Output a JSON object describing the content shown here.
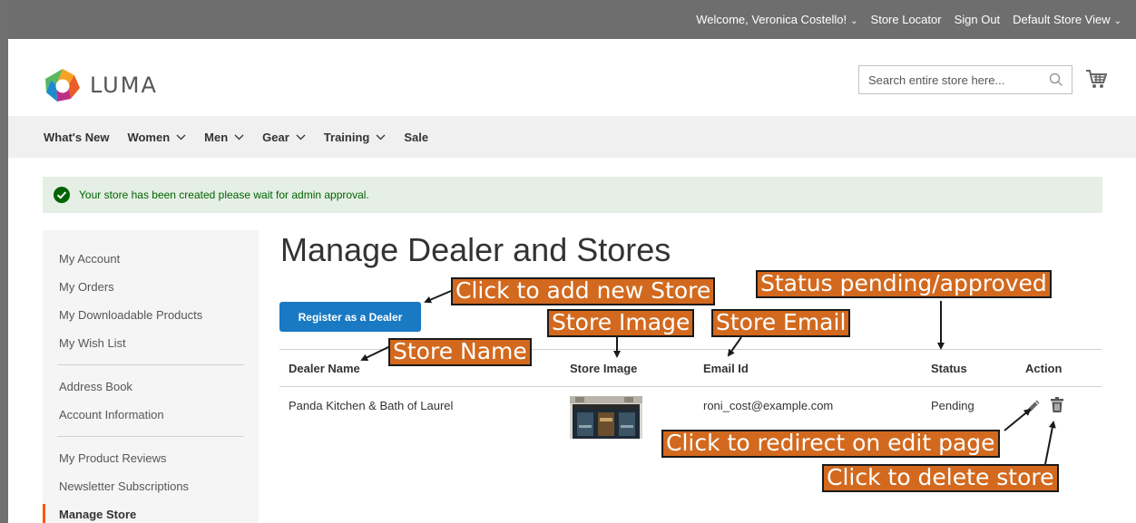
{
  "top_links": {
    "welcome": "Welcome, Veronica Costello!",
    "store_locator": "Store Locator",
    "sign_out": "Sign Out",
    "store_view": "Default Store View"
  },
  "brand": {
    "name": "LUMA"
  },
  "search": {
    "placeholder": "Search entire store here..."
  },
  "nav": {
    "items": [
      {
        "label": "What's New",
        "dropdown": false
      },
      {
        "label": "Women",
        "dropdown": true
      },
      {
        "label": "Men",
        "dropdown": true
      },
      {
        "label": "Gear",
        "dropdown": true
      },
      {
        "label": "Training",
        "dropdown": true
      },
      {
        "label": "Sale",
        "dropdown": false
      }
    ]
  },
  "message": {
    "text": "Your store has been created please wait for admin approval."
  },
  "sidebar": {
    "group1": [
      "My Account",
      "My Orders",
      "My Downloadable Products",
      "My Wish List"
    ],
    "group2": [
      "Address Book",
      "Account Information"
    ],
    "group3": [
      "My Product Reviews",
      "Newsletter Subscriptions",
      "Manage Store"
    ],
    "active": "Manage Store"
  },
  "page_title": "Manage Dealer and Stores",
  "register_button": "Register as a Dealer",
  "table": {
    "headers": {
      "dealer_name": "Dealer Name",
      "store_image": "Store Image",
      "email": "Email Id",
      "status": "Status",
      "action": "Action"
    },
    "rows": [
      {
        "dealer_name": "Panda Kitchen & Bath of Laurel",
        "email": "roni_cost@example.com",
        "status": "Pending"
      }
    ]
  },
  "annotations": {
    "add_store": "Click to add new Store",
    "status": "Status pending/approved",
    "store_image": "Store Image",
    "store_email": "Store Email",
    "store_name": "Store Name",
    "edit": "Click to redirect on edit page",
    "delete": "Click to delete store"
  },
  "colors": {
    "top_bar": "#6e6e6e",
    "nav_bg": "#f0f0f0",
    "primary_button": "#1979c3",
    "success_bg": "#e5efe5",
    "success_icon": "#006400",
    "active_marker": "#ff5501",
    "annotation_bg": "#d2691e"
  }
}
